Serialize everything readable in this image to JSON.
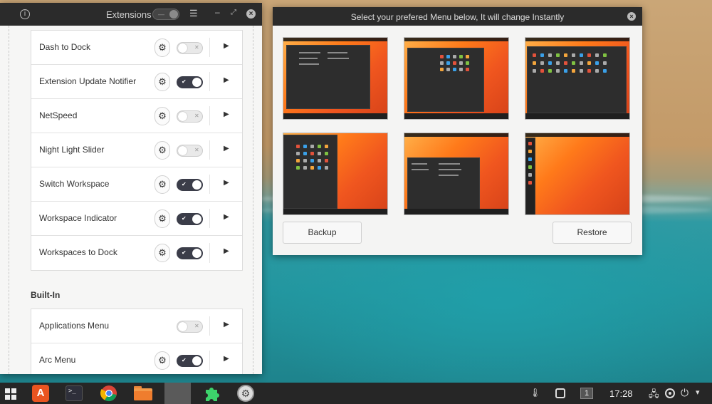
{
  "extensions_window": {
    "title": "Extensions",
    "installed": [
      {
        "name": "Dash to Dock",
        "enabled": false,
        "has_settings": true
      },
      {
        "name": "Extension Update Notifier",
        "enabled": true,
        "has_settings": true
      },
      {
        "name": "NetSpeed",
        "enabled": false,
        "has_settings": true
      },
      {
        "name": "Night Light Slider",
        "enabled": false,
        "has_settings": true
      },
      {
        "name": "Switch Workspace",
        "enabled": true,
        "has_settings": true
      },
      {
        "name": "Workspace Indicator",
        "enabled": true,
        "has_settings": true
      },
      {
        "name": "Workspaces to Dock",
        "enabled": true,
        "has_settings": true
      }
    ],
    "builtin_title": "Built-In",
    "builtin": [
      {
        "name": "Applications Menu",
        "enabled": false,
        "has_settings": false
      },
      {
        "name": "Arc Menu",
        "enabled": true,
        "has_settings": true
      }
    ]
  },
  "menu_window": {
    "title": "Select your prefered Menu below, It will change Instantly",
    "backup_label": "Backup",
    "restore_label": "Restore",
    "layouts": [
      "arc-menu-layout",
      "brisk-menu-layout",
      "whisker-grid-layout",
      "mint-menu-layout",
      "budgie-menu-layout",
      "gnome-dash-layout"
    ]
  },
  "taskbar": {
    "apps": [
      "app-store-icon",
      "terminal-icon",
      "chrome-icon",
      "files-icon",
      "blank-window",
      "extensions-icon",
      "settings-icon"
    ],
    "workspace_number": "1",
    "clock": "17:28",
    "tray_icons": [
      "notification-icon",
      "screenshot-icon",
      "network-icon",
      "arc-menu-icon",
      "power-icon"
    ]
  },
  "colors": {
    "accent_dark": "#3b3d49",
    "header_dark": "#2b2b2b",
    "taskbar": "#262626",
    "wallpaper_orange": "#f0561f",
    "extensions_green": "#3dd36b"
  }
}
